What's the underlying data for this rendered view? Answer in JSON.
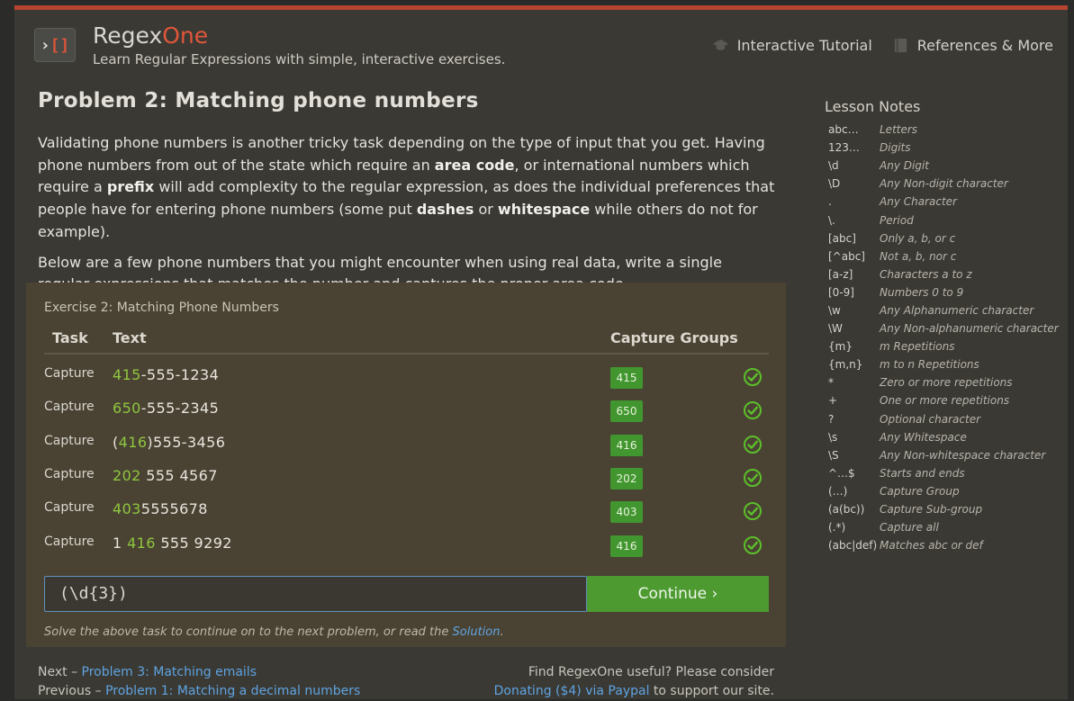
{
  "header": {
    "brand_primary": "Regex",
    "brand_accent": "One",
    "tagline": "Learn Regular Expressions with simple, interactive exercises.",
    "logo_left": "›",
    "logo_right": "[]",
    "nav": [
      {
        "label": "Interactive Tutorial",
        "icon": "graduation-cap-icon"
      },
      {
        "label": "References & More",
        "icon": "book-icon"
      }
    ]
  },
  "lesson": {
    "title": "Problem 2: Matching phone numbers",
    "p1": [
      {
        "t": "Validating phone numbers is another tricky task depending on the type of input that you get. Having phone numbers from out of the state which require an ",
        "b": false
      },
      {
        "t": "area code",
        "b": true
      },
      {
        "t": ", or international numbers which require a ",
        "b": false
      },
      {
        "t": "prefix",
        "b": true
      },
      {
        "t": " will add complexity to the regular expression, as does the individual preferences that people have for entering phone numbers (some put ",
        "b": false
      },
      {
        "t": "dashes",
        "b": true
      },
      {
        "t": " or ",
        "b": false
      },
      {
        "t": "whitespace",
        "b": true
      },
      {
        "t": " while others do not for example).",
        "b": false
      }
    ],
    "p2": "Below are a few phone numbers that you might encounter when using real data, write a single regular expressions that matches the number and captures the proper area code."
  },
  "exercise": {
    "title": "Exercise 2: Matching Phone Numbers",
    "col_task": "Task",
    "col_text": "Text",
    "col_groups": "Capture Groups",
    "rows": [
      {
        "task": "Capture",
        "parts": [
          {
            "t": "415",
            "hl": true
          },
          {
            "t": "-555-1234",
            "hl": false
          }
        ],
        "group": "415"
      },
      {
        "task": "Capture",
        "parts": [
          {
            "t": "650",
            "hl": true
          },
          {
            "t": "-555-2345",
            "hl": false
          }
        ],
        "group": "650"
      },
      {
        "task": "Capture",
        "parts": [
          {
            "t": "(",
            "hl": false
          },
          {
            "t": "416",
            "hl": true
          },
          {
            "t": ")555-3456",
            "hl": false
          }
        ],
        "group": "416"
      },
      {
        "task": "Capture",
        "parts": [
          {
            "t": "202",
            "hl": true
          },
          {
            "t": " 555 4567",
            "hl": false
          }
        ],
        "group": "202"
      },
      {
        "task": "Capture",
        "parts": [
          {
            "t": "403",
            "hl": true
          },
          {
            "t": "5555678",
            "hl": false
          }
        ],
        "group": "403"
      },
      {
        "task": "Capture",
        "parts": [
          {
            "t": "1 ",
            "hl": false
          },
          {
            "t": "416",
            "hl": true
          },
          {
            "t": " 555 9292",
            "hl": false
          }
        ],
        "group": "416"
      }
    ],
    "input_value": "(\\d{3})",
    "continue_label": "Continue ›",
    "hint_text": "Solve the above task to continue on to the next problem, or read the ",
    "hint_link": "Solution",
    "hint_end": "."
  },
  "footer": {
    "next_prefix": "Next – ",
    "next_link": "Problem 3: Matching emails",
    "prev_prefix": "Previous – ",
    "prev_link": "Problem 1: Matching a decimal numbers",
    "donate_line1": "Find RegexOne useful? Please consider",
    "donate_link": "Donating ($4) via Paypal",
    "donate_end": " to support our site."
  },
  "notes": {
    "title": "Lesson Notes",
    "items": [
      {
        "k": "abc…",
        "v": "Letters"
      },
      {
        "k": "123…",
        "v": "Digits"
      },
      {
        "k": "\\d",
        "v": "Any Digit"
      },
      {
        "k": "\\D",
        "v": "Any Non-digit character"
      },
      {
        "k": ".",
        "v": "Any Character"
      },
      {
        "k": "\\.",
        "v": "Period"
      },
      {
        "k": "[abc]",
        "v": "Only a, b, or c"
      },
      {
        "k": "[^abc]",
        "v": "Not a, b, nor c"
      },
      {
        "k": "[a-z]",
        "v": "Characters a to z"
      },
      {
        "k": "[0-9]",
        "v": "Numbers 0 to 9"
      },
      {
        "k": "\\w",
        "v": "Any Alphanumeric character"
      },
      {
        "k": "\\W",
        "v": "Any Non-alphanumeric character"
      },
      {
        "k": "{m}",
        "v": "m Repetitions"
      },
      {
        "k": "{m,n}",
        "v": "m to n Repetitions"
      },
      {
        "k": "*",
        "v": "Zero or more repetitions"
      },
      {
        "k": "+",
        "v": "One or more repetitions"
      },
      {
        "k": "?",
        "v": "Optional character"
      },
      {
        "k": "\\s",
        "v": "Any Whitespace"
      },
      {
        "k": "\\S",
        "v": "Any Non-whitespace character"
      },
      {
        "k": "^…$",
        "v": "Starts and ends"
      },
      {
        "k": "(…)",
        "v": "Capture Group"
      },
      {
        "k": "(a(bc))",
        "v": "Capture Sub-group"
      },
      {
        "k": "(.*)",
        "v": "Capture all"
      },
      {
        "k": "(abc|def)",
        "v": "Matches abc or def"
      }
    ]
  },
  "colors": {
    "accent": "#e0573b",
    "highlight": "#8ec63f",
    "badge": "#41962f",
    "button": "#4d9a31",
    "link": "#5fa3e0"
  }
}
